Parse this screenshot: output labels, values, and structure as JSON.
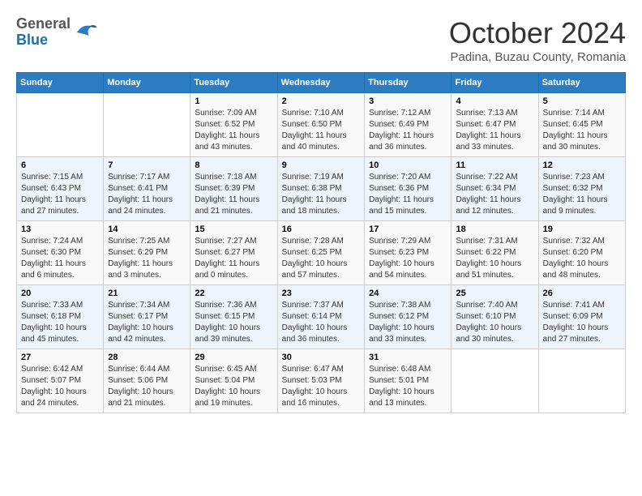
{
  "header": {
    "logo": {
      "general": "General",
      "blue": "Blue"
    },
    "title": "October 2024",
    "subtitle": "Padina, Buzau County, Romania"
  },
  "calendar": {
    "days_of_week": [
      "Sunday",
      "Monday",
      "Tuesday",
      "Wednesday",
      "Thursday",
      "Friday",
      "Saturday"
    ],
    "weeks": [
      [
        {
          "day": "",
          "info": ""
        },
        {
          "day": "",
          "info": ""
        },
        {
          "day": "1",
          "info": "Sunrise: 7:09 AM\nSunset: 6:52 PM\nDaylight: 11 hours and 43 minutes."
        },
        {
          "day": "2",
          "info": "Sunrise: 7:10 AM\nSunset: 6:50 PM\nDaylight: 11 hours and 40 minutes."
        },
        {
          "day": "3",
          "info": "Sunrise: 7:12 AM\nSunset: 6:49 PM\nDaylight: 11 hours and 36 minutes."
        },
        {
          "day": "4",
          "info": "Sunrise: 7:13 AM\nSunset: 6:47 PM\nDaylight: 11 hours and 33 minutes."
        },
        {
          "day": "5",
          "info": "Sunrise: 7:14 AM\nSunset: 6:45 PM\nDaylight: 11 hours and 30 minutes."
        }
      ],
      [
        {
          "day": "6",
          "info": "Sunrise: 7:15 AM\nSunset: 6:43 PM\nDaylight: 11 hours and 27 minutes."
        },
        {
          "day": "7",
          "info": "Sunrise: 7:17 AM\nSunset: 6:41 PM\nDaylight: 11 hours and 24 minutes."
        },
        {
          "day": "8",
          "info": "Sunrise: 7:18 AM\nSunset: 6:39 PM\nDaylight: 11 hours and 21 minutes."
        },
        {
          "day": "9",
          "info": "Sunrise: 7:19 AM\nSunset: 6:38 PM\nDaylight: 11 hours and 18 minutes."
        },
        {
          "day": "10",
          "info": "Sunrise: 7:20 AM\nSunset: 6:36 PM\nDaylight: 11 hours and 15 minutes."
        },
        {
          "day": "11",
          "info": "Sunrise: 7:22 AM\nSunset: 6:34 PM\nDaylight: 11 hours and 12 minutes."
        },
        {
          "day": "12",
          "info": "Sunrise: 7:23 AM\nSunset: 6:32 PM\nDaylight: 11 hours and 9 minutes."
        }
      ],
      [
        {
          "day": "13",
          "info": "Sunrise: 7:24 AM\nSunset: 6:30 PM\nDaylight: 11 hours and 6 minutes."
        },
        {
          "day": "14",
          "info": "Sunrise: 7:25 AM\nSunset: 6:29 PM\nDaylight: 11 hours and 3 minutes."
        },
        {
          "day": "15",
          "info": "Sunrise: 7:27 AM\nSunset: 6:27 PM\nDaylight: 11 hours and 0 minutes."
        },
        {
          "day": "16",
          "info": "Sunrise: 7:28 AM\nSunset: 6:25 PM\nDaylight: 10 hours and 57 minutes."
        },
        {
          "day": "17",
          "info": "Sunrise: 7:29 AM\nSunset: 6:23 PM\nDaylight: 10 hours and 54 minutes."
        },
        {
          "day": "18",
          "info": "Sunrise: 7:31 AM\nSunset: 6:22 PM\nDaylight: 10 hours and 51 minutes."
        },
        {
          "day": "19",
          "info": "Sunrise: 7:32 AM\nSunset: 6:20 PM\nDaylight: 10 hours and 48 minutes."
        }
      ],
      [
        {
          "day": "20",
          "info": "Sunrise: 7:33 AM\nSunset: 6:18 PM\nDaylight: 10 hours and 45 minutes."
        },
        {
          "day": "21",
          "info": "Sunrise: 7:34 AM\nSunset: 6:17 PM\nDaylight: 10 hours and 42 minutes."
        },
        {
          "day": "22",
          "info": "Sunrise: 7:36 AM\nSunset: 6:15 PM\nDaylight: 10 hours and 39 minutes."
        },
        {
          "day": "23",
          "info": "Sunrise: 7:37 AM\nSunset: 6:14 PM\nDaylight: 10 hours and 36 minutes."
        },
        {
          "day": "24",
          "info": "Sunrise: 7:38 AM\nSunset: 6:12 PM\nDaylight: 10 hours and 33 minutes."
        },
        {
          "day": "25",
          "info": "Sunrise: 7:40 AM\nSunset: 6:10 PM\nDaylight: 10 hours and 30 minutes."
        },
        {
          "day": "26",
          "info": "Sunrise: 7:41 AM\nSunset: 6:09 PM\nDaylight: 10 hours and 27 minutes."
        }
      ],
      [
        {
          "day": "27",
          "info": "Sunrise: 6:42 AM\nSunset: 5:07 PM\nDaylight: 10 hours and 24 minutes."
        },
        {
          "day": "28",
          "info": "Sunrise: 6:44 AM\nSunset: 5:06 PM\nDaylight: 10 hours and 21 minutes."
        },
        {
          "day": "29",
          "info": "Sunrise: 6:45 AM\nSunset: 5:04 PM\nDaylight: 10 hours and 19 minutes."
        },
        {
          "day": "30",
          "info": "Sunrise: 6:47 AM\nSunset: 5:03 PM\nDaylight: 10 hours and 16 minutes."
        },
        {
          "day": "31",
          "info": "Sunrise: 6:48 AM\nSunset: 5:01 PM\nDaylight: 10 hours and 13 minutes."
        },
        {
          "day": "",
          "info": ""
        },
        {
          "day": "",
          "info": ""
        }
      ]
    ]
  }
}
